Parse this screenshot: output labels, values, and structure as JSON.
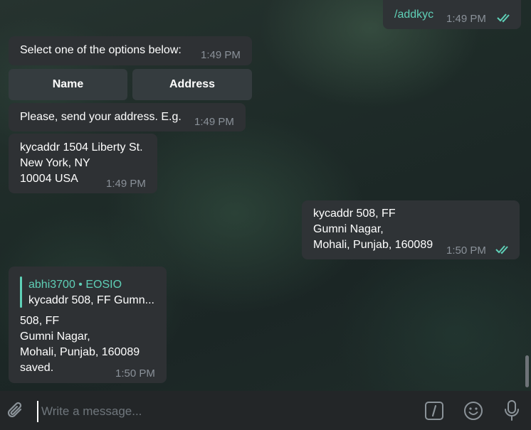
{
  "messages": {
    "m1": {
      "text": "/addkyc",
      "time": "1:49 PM"
    },
    "m2": {
      "text": "Select one of the options below:",
      "time": "1:49 PM"
    },
    "keyboard": {
      "btn1": "Name",
      "btn2": "Address"
    },
    "m3": {
      "text": "Please, send your address. E.g.",
      "time": "1:49 PM"
    },
    "m4": {
      "lines": "kycaddr 1504 Liberty St.\nNew York, NY\n10004 USA",
      "time": "1:49 PM"
    },
    "m5": {
      "lines": "kycaddr 508, FF\nGumni Nagar,\nMohali, Punjab, 160089",
      "time": "1:50 PM"
    },
    "m6": {
      "reply_name": "abhi3700 • EOSIO",
      "reply_text": "kycaddr 508, FF Gumn...",
      "lines": "508, FF\nGumni Nagar,\nMohali, Punjab, 160089\nsaved.",
      "time": "1:50 PM"
    }
  },
  "composer": {
    "placeholder": "Write a message..."
  },
  "icons": {
    "attach": "paperclip-icon",
    "commands": "slash-command-icon",
    "emoji": "emoji-icon",
    "voice": "microphone-icon"
  },
  "colors": {
    "accent": "#5fd0b7",
    "bubble": "#2f3235",
    "composer": "#232628"
  }
}
